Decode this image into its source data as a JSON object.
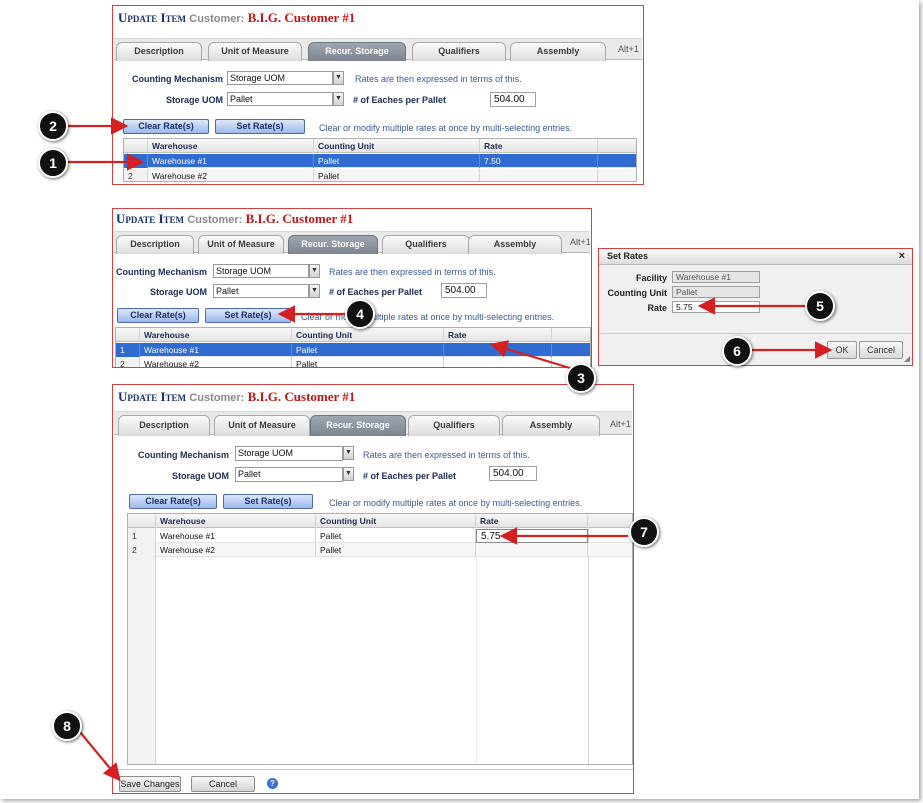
{
  "form": {
    "title_word1": "Update Item",
    "title_customer_label": "Customer:",
    "title_customer_name": "B.I.G. Customer #1",
    "tabs": [
      "Description",
      "Unit of Measure",
      "Recur. Storage",
      "Qualifiers",
      "Assembly"
    ],
    "tab_more": "Alt+1",
    "counting_mechanism_label": "Counting Mechanism",
    "counting_mechanism_value": "Storage UOM",
    "rates_hint": "Rates are then expressed in terms of this.",
    "storage_uom_label": "Storage UOM",
    "storage_uom_value": "Pallet",
    "eaches_label": "# of Eaches per Pallet",
    "eaches_value": "504.00",
    "clear_rates_label": "Clear Rate(s)",
    "set_rates_label": "Set Rate(s)",
    "multi_hint": "Clear or modify multiple rates at once by multi-selecting entries.",
    "columns": [
      "Warehouse",
      "Counting Unit",
      "Rate"
    ]
  },
  "step1": {
    "rows": [
      {
        "num": "",
        "warehouse": "Warehouse #1",
        "unit": "Pallet",
        "rate": "7.50"
      },
      {
        "num": "2",
        "warehouse": "Warehouse #2",
        "unit": "Pallet",
        "rate": ""
      }
    ]
  },
  "step2": {
    "rows": [
      {
        "num": "1",
        "warehouse": "Warehouse #1",
        "unit": "Pallet",
        "rate": ""
      },
      {
        "num": "2",
        "warehouse": "Warehouse #2",
        "unit": "Pallet",
        "rate": ""
      }
    ]
  },
  "step3": {
    "rows": [
      {
        "num": "1",
        "warehouse": "Warehouse #1",
        "unit": "Pallet",
        "rate": "5.75"
      },
      {
        "num": "2",
        "warehouse": "Warehouse #2",
        "unit": "Pallet",
        "rate": ""
      }
    ]
  },
  "dialog": {
    "title": "Set Rates",
    "close": "×",
    "facility_label": "Facility",
    "facility_value": "Warehouse #1",
    "counting_unit_label": "Counting Unit",
    "counting_unit_value": "Pallet",
    "rate_label": "Rate",
    "rate_value": "5.75",
    "ok_label": "OK",
    "cancel_label": "Cancel"
  },
  "footer": {
    "save_label": "Save Changes",
    "cancel_label": "Cancel",
    "help": "?"
  },
  "markers": [
    "1",
    "2",
    "3",
    "4",
    "5",
    "6",
    "7",
    "8"
  ],
  "colors": {
    "accent_red": "#d42020",
    "selection_blue": "#2f6bd0",
    "title_navy": "#1a2f6e",
    "customer_red": "#c01818"
  }
}
